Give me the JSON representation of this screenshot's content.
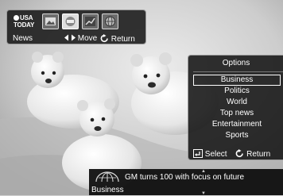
{
  "widget_bar": {
    "logo_text": "USA TODAY",
    "category_label": "News",
    "move_hint": "Move",
    "return_hint": "Return",
    "tiles": [
      "photos-icon",
      "usa-today-widget-icon",
      "stocks-icon",
      "globe-icon"
    ]
  },
  "options": {
    "title": "Options",
    "items": [
      "Business",
      "Politics",
      "World",
      "Top news",
      "Entertainment",
      "Sports"
    ],
    "selected": "Business",
    "select_label": "Select",
    "return_label": "Return"
  },
  "ticker": {
    "headline": "GM turns 100 with focus on future",
    "category": "Business"
  },
  "colors": {
    "panel_bg": "#141414",
    "panel_border": "#9a9a9a",
    "text": "#ffffff"
  }
}
